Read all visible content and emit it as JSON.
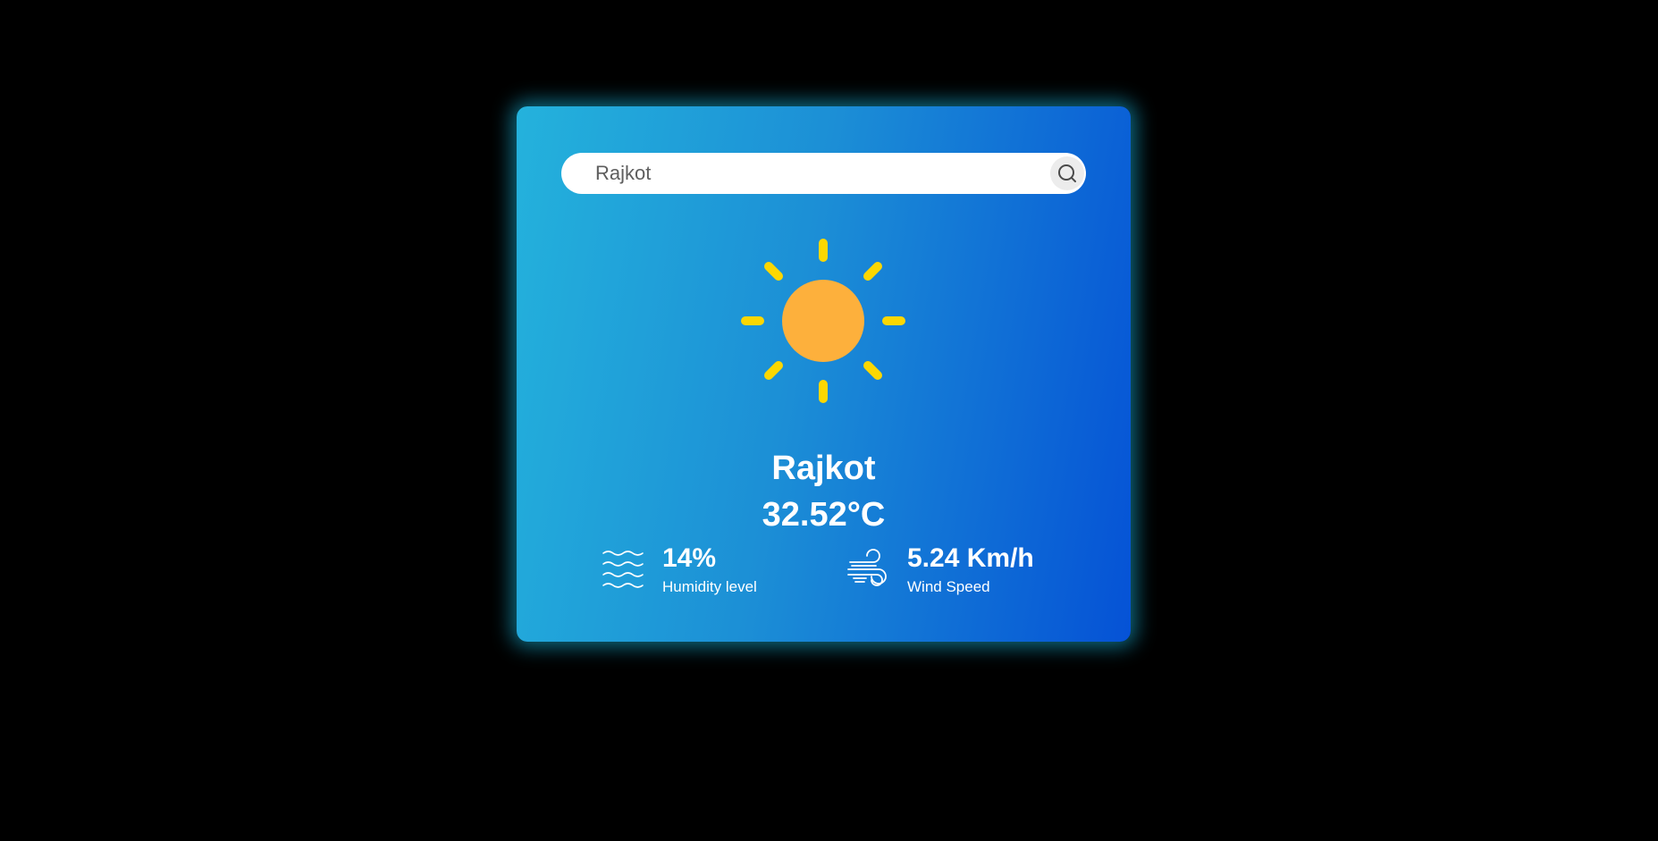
{
  "search": {
    "value": "Rajkot",
    "icon": "search-icon"
  },
  "weather": {
    "icon": "sun-icon",
    "city": "Rajkot",
    "temperature": "32.52°C"
  },
  "humidity": {
    "icon": "humidity-waves-icon",
    "value": "14%",
    "label": "Humidity level"
  },
  "wind": {
    "icon": "wind-icon",
    "value": "5.24 Km/h",
    "label": "Wind Speed"
  },
  "colors": {
    "background": "#000000",
    "card_gradient_start": "#24b2dc",
    "card_gradient_end": "#0552d6",
    "card_glow": "#19bee6",
    "sun_body": "#fdb03c",
    "sun_rays": "#fcd700",
    "text": "#ffffff"
  }
}
